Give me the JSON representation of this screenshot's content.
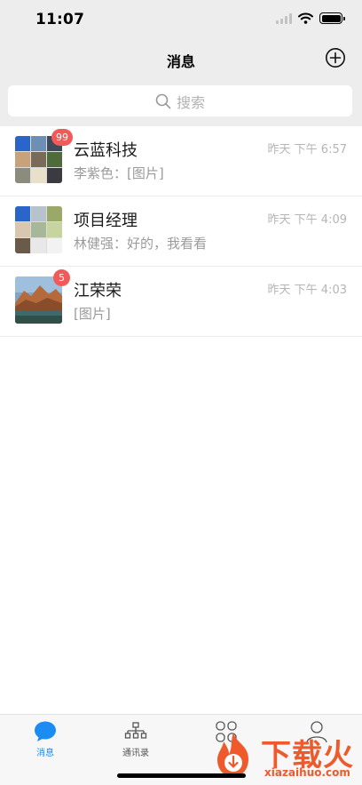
{
  "status_bar": {
    "time": "11:07"
  },
  "nav": {
    "title": "消息",
    "add_icon": "plus-circle-icon"
  },
  "search": {
    "placeholder": "搜索",
    "icon": "search-icon"
  },
  "conversations": [
    {
      "name": "云蓝科技",
      "preview": "李紫色：[图片]",
      "time": "昨天 下午 6:57",
      "badge": "99",
      "avatar_type": "group-grid"
    },
    {
      "name": "项目经理",
      "preview": "林健强：好的，我看看",
      "time": "昨天 下午 4:09",
      "badge": "",
      "avatar_type": "group-grid"
    },
    {
      "name": "江荣荣",
      "preview": "[图片]",
      "time": "昨天 下午 4:03",
      "badge": "5",
      "avatar_type": "landscape-photo"
    }
  ],
  "tabs": [
    {
      "label": "消息",
      "icon": "chat-bubble-icon",
      "active": true
    },
    {
      "label": "通讯录",
      "icon": "org-chart-icon",
      "active": false
    },
    {
      "label": "",
      "icon": "apps-grid-icon",
      "active": false
    },
    {
      "label": "",
      "icon": "person-icon",
      "active": false
    }
  ],
  "watermark": {
    "text": "下载火",
    "subtext": "xiazaihuo.com"
  },
  "colors": {
    "accent": "#1b8cf2",
    "badge": "#f05b5a",
    "header_bg": "#ededed"
  }
}
